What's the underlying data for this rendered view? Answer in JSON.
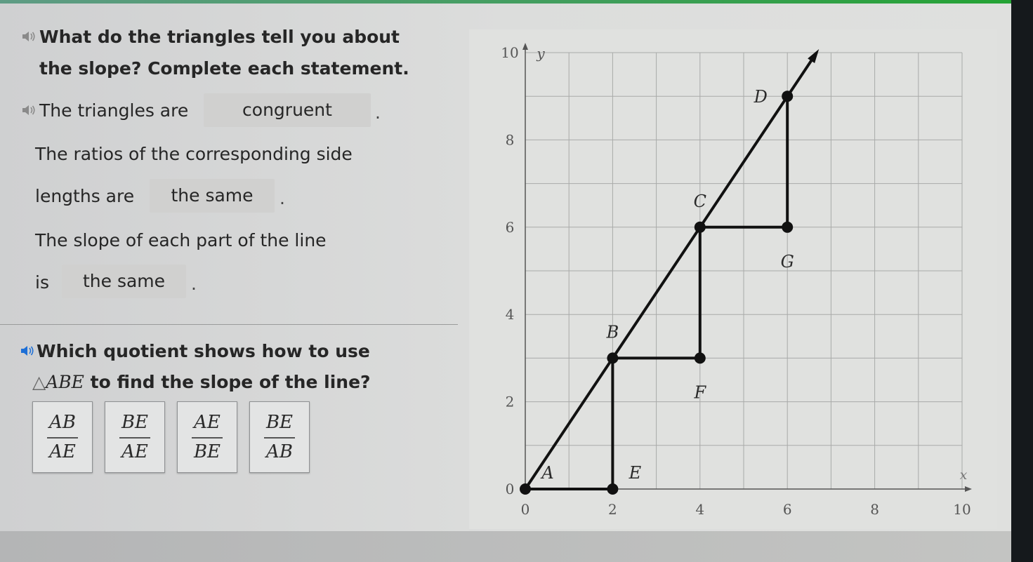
{
  "question1": {
    "line1": "What do the triangles tell you about",
    "line2": "the slope? Complete each statement."
  },
  "statement1": {
    "prefix": "The triangles are",
    "answer": "congruent",
    "suffix": "."
  },
  "statement2": {
    "line1": "The ratios of the corresponding side",
    "prefix": "lengths are",
    "answer": "the same",
    "suffix": "."
  },
  "statement3": {
    "line1": "The slope of each part of the line",
    "prefix": "is",
    "answer": "the same",
    "suffix": "."
  },
  "question2": {
    "line1": "Which quotient shows how to use",
    "triangle_symbol": "△",
    "triangle_name": "ABE",
    "line2_rest": " to find the slope of the line?"
  },
  "choices": [
    {
      "numerator": "AB",
      "denominator": "AE"
    },
    {
      "numerator": "BE",
      "denominator": "AE"
    },
    {
      "numerator": "AE",
      "denominator": "BE"
    },
    {
      "numerator": "BE",
      "denominator": "AB"
    }
  ],
  "icons": {
    "speaker": "speaker-icon"
  },
  "colors": {
    "accent_green": "#24a334",
    "active_speaker": "#1e6fd6",
    "inactive_speaker": "#8a8a8a"
  },
  "chart_data": {
    "type": "line",
    "title": "",
    "xlabel": "x",
    "ylabel": "y",
    "xlim": [
      0,
      10
    ],
    "ylim": [
      0,
      10
    ],
    "x_ticks": [
      0,
      2,
      4,
      6,
      8,
      10
    ],
    "y_ticks": [
      0,
      2,
      4,
      6,
      8,
      10
    ],
    "grid": true,
    "grid_step": 1,
    "line": {
      "from": [
        0,
        0
      ],
      "to": [
        6.67,
        10
      ],
      "arrow": true,
      "slope": 1.5
    },
    "points": [
      {
        "label": "A",
        "x": 0,
        "y": 0,
        "label_pos": "upper-right"
      },
      {
        "label": "B",
        "x": 2,
        "y": 3,
        "label_pos": "above"
      },
      {
        "label": "C",
        "x": 4,
        "y": 6,
        "label_pos": "above"
      },
      {
        "label": "D",
        "x": 6,
        "y": 9,
        "label_pos": "left"
      },
      {
        "label": "E",
        "x": 2,
        "y": 0,
        "label_pos": "upper-right"
      },
      {
        "label": "F",
        "x": 4,
        "y": 3,
        "label_pos": "below"
      },
      {
        "label": "G",
        "x": 6,
        "y": 6,
        "label_pos": "below"
      }
    ],
    "triangles": [
      {
        "name": "ABE",
        "vertices": [
          "A",
          "B",
          "E"
        ]
      },
      {
        "name": "BCF",
        "vertices": [
          "B",
          "C",
          "F"
        ]
      },
      {
        "name": "CDG",
        "vertices": [
          "C",
          "D",
          "G"
        ]
      }
    ]
  }
}
